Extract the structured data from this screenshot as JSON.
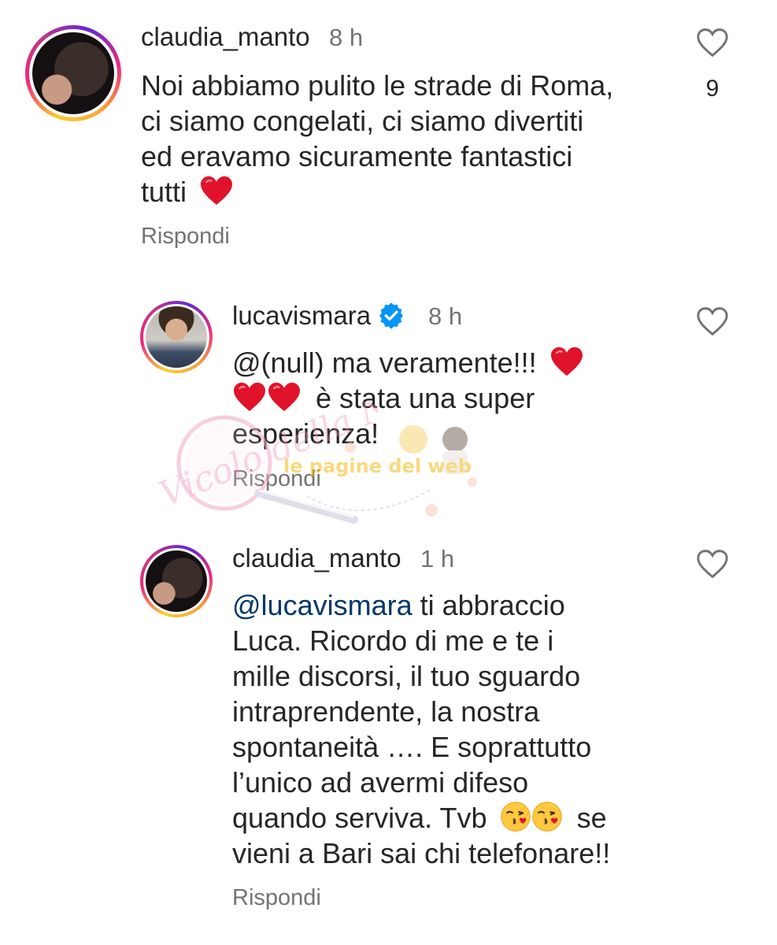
{
  "comments": [
    {
      "username": "claudia_manto",
      "time": "8 h",
      "lines": [
        "Noi abbiamo pulito le strade di Roma,",
        "ci siamo congelati, ci siamo divertiti",
        "ed eravamo sicuramente fantastici",
        "tutti"
      ],
      "reply_label": "Rispondi",
      "likes": "9"
    },
    {
      "username": "lucavismara",
      "time": "8 h",
      "lines": [
        "@(null) ma veramente!!!",
        "è stata una super",
        "esperienza!"
      ],
      "reply_label": "Rispondi"
    },
    {
      "username": "claudia_manto",
      "time": "1 h",
      "mention": "@lucavismara",
      "lines": [
        "ti abbraccio",
        "Luca. Ricordo di me e te i",
        "mille discorsi, il tuo sguardo",
        "intraprendente, la nostra",
        "spontaneità …. E soprattutto",
        "l’unico ad avermi difeso",
        "quando serviva. Tvb",
        "se",
        "vieni a Bari sai chi telefonare!!"
      ],
      "reply_label": "Rispondi"
    }
  ],
  "watermarks": {
    "left_script": "Vicolo della News",
    "right_banner": "le pagine del web"
  },
  "icons": {
    "like": "heart-outline-icon",
    "verified": "verified-badge-icon",
    "red_heart": "red-heart-emoji",
    "kiss": "kissing-face-emoji"
  },
  "colors": {
    "text": "#262626",
    "secondary": "#737373",
    "mention": "#00376b",
    "verified": "#0095f6",
    "heart_emoji": "#e0132a"
  }
}
